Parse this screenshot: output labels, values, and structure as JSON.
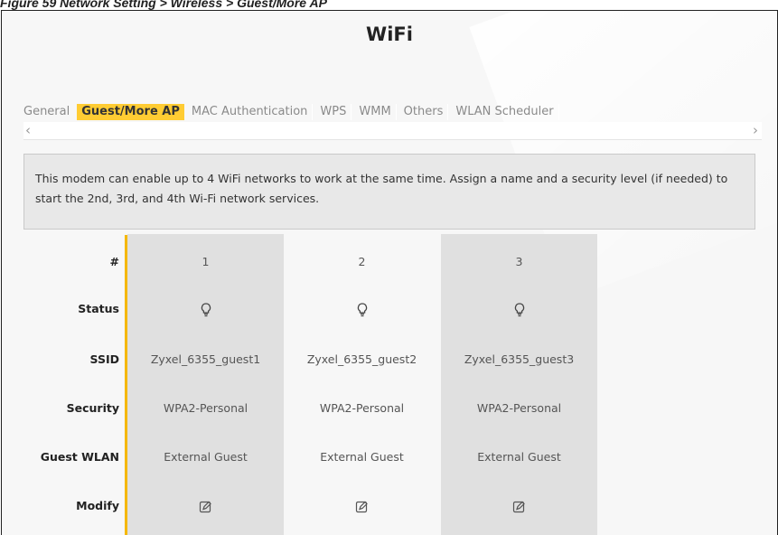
{
  "caption": "Figure 59   Network Setting > Wireless > Guest/More AP",
  "title": "WiFi",
  "tabs": [
    {
      "label": "General",
      "active": false
    },
    {
      "label": "Guest/More AP",
      "active": true
    },
    {
      "label": "MAC Authentication",
      "active": false
    },
    {
      "label": "WPS",
      "active": false
    },
    {
      "label": "WMM",
      "active": false
    },
    {
      "label": "Others",
      "active": false
    },
    {
      "label": "WLAN Scheduler",
      "active": false
    }
  ],
  "scroll": {
    "left_icon": "chevron-left-icon",
    "right_icon": "chevron-right-icon"
  },
  "info_text": "This modem can enable up to 4 WiFi networks to work at the same time. Assign a name and a security level (if needed) to start the 2nd, 3rd, and 4th Wi-Fi network services.",
  "table": {
    "row_labels": {
      "index": "#",
      "status": "Status",
      "ssid": "SSID",
      "security": "Security",
      "guest_wlan": "Guest WLAN",
      "modify": "Modify"
    },
    "rows": [
      {
        "index": "1",
        "status_icon": "bulb-icon",
        "ssid": "Zyxel_6355_guest1",
        "security": "WPA2-Personal",
        "guest_wlan": "External Guest",
        "modify_icon": "edit-icon"
      },
      {
        "index": "2",
        "status_icon": "bulb-icon",
        "ssid": "Zyxel_6355_guest2",
        "security": "WPA2-Personal",
        "guest_wlan": "External Guest",
        "modify_icon": "edit-icon"
      },
      {
        "index": "3",
        "status_icon": "bulb-icon",
        "ssid": "Zyxel_6355_guest3",
        "security": "WPA2-Personal",
        "guest_wlan": "External Guest",
        "modify_icon": "edit-icon"
      }
    ]
  },
  "colors": {
    "accent": "#ffcc33",
    "divider": "#f5b800",
    "shaded_column": "#e0e0e0"
  }
}
